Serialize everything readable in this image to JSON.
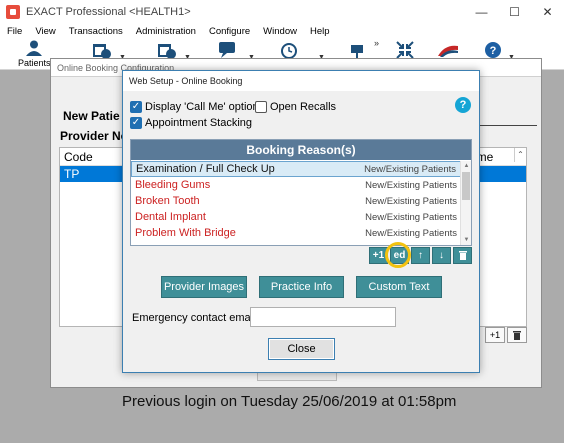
{
  "app": {
    "title": "EXACT Professional <HEALTH1>",
    "window_controls": {
      "minimize": "—",
      "maximize": "☐",
      "close": "✕"
    }
  },
  "menu": [
    "File",
    "View",
    "Transactions",
    "Administration",
    "Configure",
    "Window",
    "Help"
  ],
  "toolbar": {
    "patients_label": "Patients",
    "more": "»"
  },
  "config_window": {
    "title": "Online Booking Configuration",
    "new_heading": "New Patie",
    "provider_heading": "Provider Ne",
    "list_header": "Code",
    "selected_code": "TP",
    "right_header": "ime",
    "plus_one": "+1"
  },
  "dialog": {
    "title": "Web Setup - Online Booking",
    "display_call_me": {
      "label": "Display 'Call Me' option",
      "checked": true
    },
    "open_recalls": {
      "label": "Open Recalls",
      "checked": false
    },
    "appointment_stacking": {
      "label": "Appointment Stacking",
      "checked": true
    },
    "help": "?",
    "reasons_header": "Booking Reason(s)",
    "reasons": [
      {
        "name": "Examination / Full Check Up",
        "type": "New/Existing Patients",
        "selected": true
      },
      {
        "name": "Bleeding Gums",
        "type": "New/Existing Patients",
        "selected": false
      },
      {
        "name": "Broken Tooth",
        "type": "New/Existing Patients",
        "selected": false
      },
      {
        "name": "Dental Implant",
        "type": "New/Existing Patients",
        "selected": false
      },
      {
        "name": "Problem With Bridge",
        "type": "New/Existing Patients",
        "selected": false
      }
    ],
    "tools": {
      "add": "+1",
      "edit": "ed",
      "up": "↑",
      "down": "↓"
    },
    "provider_images": "Provider Images",
    "practice_info": "Practice Info",
    "custom_text": "Custom Text",
    "emergency_label": "Emergency contact email",
    "emergency_value": "",
    "close": "Close"
  },
  "status": {
    "previous_login": "Previous login on Tuesday 25/06/2019 at 01:58pm"
  },
  "colors": {
    "teal_button": "#3f8f98",
    "header_blue": "#5a7a98",
    "selection_blue": "#0078d7",
    "highlight_ring": "#f3c20f",
    "reason_text_red": "#cc2222"
  }
}
